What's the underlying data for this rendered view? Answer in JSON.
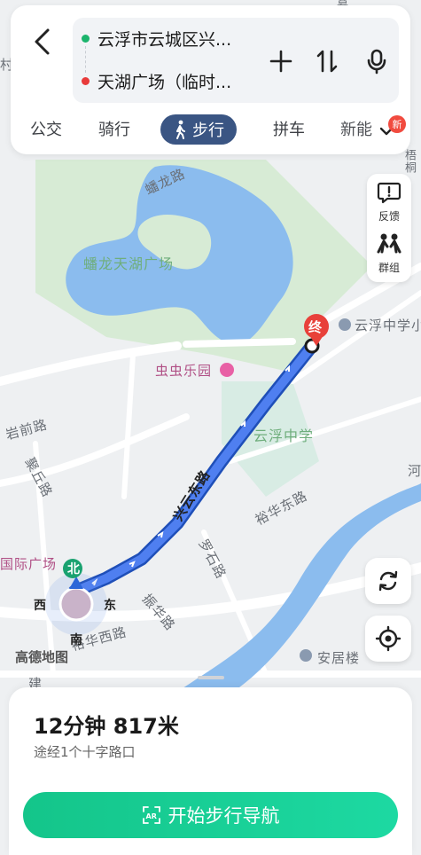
{
  "header": {
    "origin": "云浮市云城区兴...",
    "destination": "天湖广场（临时...",
    "origin_color": "#1bb46c",
    "destination_color": "#e83a3a"
  },
  "modes": [
    {
      "label": "公交"
    },
    {
      "label": "骑行"
    },
    {
      "label": "步行",
      "active": true
    },
    {
      "label": "拼车"
    },
    {
      "label": "新能"
    }
  ],
  "new_badge": "新",
  "side_panel": {
    "feedback": "反馈",
    "group": "群组"
  },
  "map": {
    "labels": {
      "panlong_road": "蟠龙路",
      "lake_square": "蟠龙天湖广场",
      "chongchong": "虫虫乐园",
      "yunfu_middle_small": "云浮中学小",
      "yunfu_middle": "云浮中学",
      "yanqian_road": "岩前路",
      "xingyun_east": "兴云东路",
      "yuhua_east": "裕华东路",
      "luoshi_road": "罗石路",
      "zhenhua_road": "振华路",
      "yuhua_west": "裕华西路",
      "guoji_square": "国际广场",
      "anchen_tower": "安居楼",
      "guqiu_road": "聚丘路",
      "wutong": "梧桐",
      "river": "河",
      "county": "村",
      "jian": "建",
      "gu": "墓"
    },
    "compass": {
      "north": "北",
      "south": "南",
      "east": "东",
      "west": "西"
    },
    "end_marker": "终",
    "route_color": "#3d6fe0",
    "water_color": "#7fb4ee",
    "park_color": "#d5ead3"
  },
  "logo": "高德地图",
  "summary": {
    "eta": "12分钟  817米",
    "via": "途经1个十字路口",
    "start_button": "开始步行导航",
    "start_color": "#17cc93"
  }
}
